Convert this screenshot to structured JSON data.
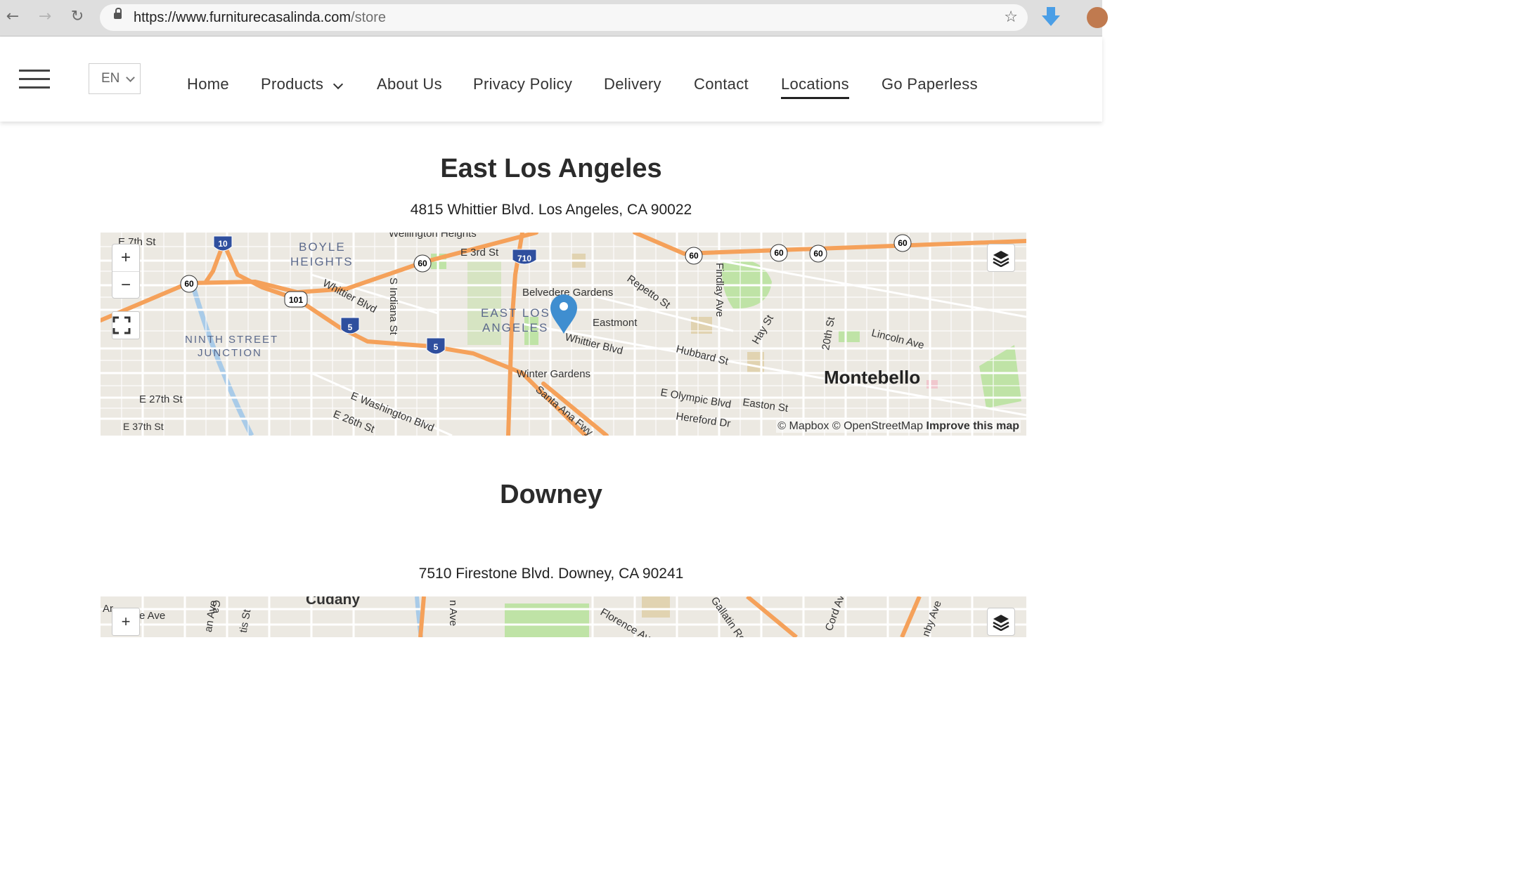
{
  "browser": {
    "url_host": "https://www.furniturecasalinda.com",
    "url_path": "/store",
    "back_icon": "←",
    "forward_icon": "→",
    "reload_icon": "↻",
    "star_icon": "☆"
  },
  "header": {
    "language": "EN",
    "nav": [
      {
        "label": "Home"
      },
      {
        "label": "Products"
      },
      {
        "label": "About Us"
      },
      {
        "label": "Privacy Policy"
      },
      {
        "label": "Delivery"
      },
      {
        "label": "Contact"
      },
      {
        "label": "Locations",
        "active": true
      },
      {
        "label": "Go Paperless"
      }
    ]
  },
  "locations": [
    {
      "name": "East Los Angeles",
      "address": "4815 Whittier Blvd. Los Angeles, CA 90022",
      "map": {
        "zoom_in": "+",
        "zoom_out": "−",
        "attribution_prefix": "© Mapbox © OpenStreetMap",
        "improve": "Improve this map",
        "labels": {
          "e7th": "E 7th St",
          "wellington": "Wellington Heights",
          "e3rd": "E 3rd St",
          "boyle1": "BOYLE",
          "boyle2": "HEIGHTS",
          "whittier1": "Whittier Blvd",
          "indiana": "S Indiana St",
          "ela1": "EAST LOS",
          "ela2": "ANGELES",
          "belvedere": "Belvedere Gardens",
          "repetto": "Repetto St",
          "eastmont": "Eastmont",
          "whittier2": "Whittier Blvd",
          "findlay": "Findlay Ave",
          "hay": "Hay St",
          "twentieth": "20th St",
          "lincoln": "Lincoln Ave",
          "hubbard": "Hubbard St",
          "montebello": "Montebello",
          "ninth1": "NINTH STREET",
          "ninth2": "JUNCTION",
          "winter": "Winter Gardens",
          "santaana": "Santa Ana Fwy",
          "olympic": "E Olympic Blvd",
          "easton": "Easton St",
          "hereford": "Hereford Dr",
          "e27": "E 27th St",
          "e37": "E 37th St",
          "washington": "E Washington Blvd",
          "e26": "E 26th St",
          "sh60": "60",
          "sh101": "101",
          "sh5": "5",
          "sh10": "10",
          "sh710": "710"
        }
      }
    },
    {
      "name": "Downey",
      "address": "7510 Firestone Blvd.  Downey, CA 90241",
      "map": {
        "zoom_in": "+",
        "labels": {
          "cudahy": "Cudahy",
          "florence": "Florence Ave",
          "gallatin": "Gallatin Rd",
          "cord": "Cord Ave",
          "eave": "e Ave",
          "ar": "Ar",
          "ca": "Ca",
          "anave": "an Ave",
          "tisst": "tis St",
          "nave": "n Ave",
          "byave": "nby Ave"
        }
      }
    }
  ],
  "colors": {
    "highway": "#f5a15a",
    "interstate": "#2f4f9e",
    "marker": "#3f8ed0",
    "park": "#bfe3a6",
    "water": "#a9cbe8",
    "map_bg": "#ece9e2"
  }
}
